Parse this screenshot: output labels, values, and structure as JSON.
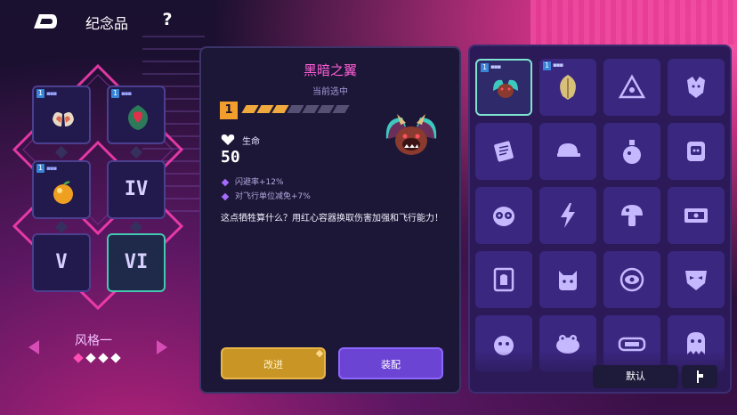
{
  "topbar": {
    "title": "纪念品",
    "help": "?"
  },
  "loadout": {
    "slots": [
      {
        "badge": "1",
        "dots": "▪▪▪",
        "icon": "wings-icon"
      },
      {
        "badge": "1",
        "dots": "▪▪▪",
        "icon": "demon-heart-icon"
      },
      {
        "badge": "1",
        "dots": "▪▪▪",
        "icon": "golden-apple-icon"
      },
      {
        "roman": "IV"
      },
      {
        "roman": "V"
      },
      {
        "roman": "VI"
      }
    ],
    "style_label": "风格一",
    "page_dots": 4,
    "active_dot": 0
  },
  "detail": {
    "name": "黑暗之翼",
    "status": "当前选中",
    "tier": "1",
    "pips_filled": 3,
    "pips_total": 7,
    "stat_label": "生命",
    "stat_value": "50",
    "effects": [
      "闪避率+12%",
      "对飞行单位减免+7%"
    ],
    "description": "这点牺牲算什么？用红心容器换取伤害加强和飞行能力！",
    "upgrade_label": "改进",
    "equip_label": "装配"
  },
  "collection": {
    "items": [
      {
        "icon": "dark-wings-icon",
        "badge": "1",
        "dots": "▪▪▪",
        "selected": true
      },
      {
        "icon": "leaf-icon",
        "badge": "1",
        "dots": "▪▪▪"
      },
      {
        "icon": "eye-triangle-icon"
      },
      {
        "icon": "wolf-head-icon"
      },
      {
        "icon": "scroll-icon"
      },
      {
        "icon": "cap-icon"
      },
      {
        "icon": "potion-icon"
      },
      {
        "icon": "skull-jar-icon"
      },
      {
        "icon": "owl-icon"
      },
      {
        "icon": "lightning-icon"
      },
      {
        "icon": "mushroom-icon"
      },
      {
        "icon": "cash-icon"
      },
      {
        "icon": "tablet-icon"
      },
      {
        "icon": "cat-icon"
      },
      {
        "icon": "eye-icon"
      },
      {
        "icon": "mask-icon"
      },
      {
        "icon": "bomb-icon"
      },
      {
        "icon": "frog-icon"
      },
      {
        "icon": "tag-icon"
      },
      {
        "icon": "ghost-icon"
      }
    ],
    "default_label": "默认"
  }
}
